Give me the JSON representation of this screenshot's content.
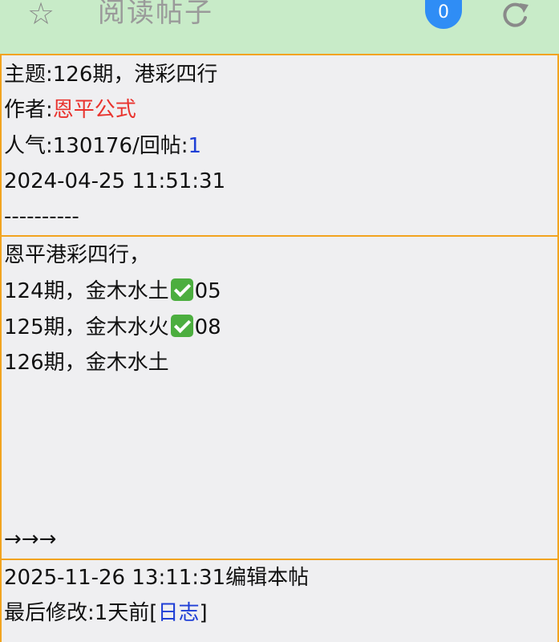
{
  "header": {
    "star_icon": "☆",
    "title": "阅读帖子",
    "badge_count": "0",
    "refresh_icon": "refresh-icon"
  },
  "post_info": {
    "subject_label": "主题:",
    "subject_value": "126期，港彩四行",
    "author_label": "作者:",
    "author_value": "恩平公式",
    "popularity_label": "人气:130176/回帖:",
    "reply_count": "1",
    "timestamp": "2024-04-25 11:51:31",
    "divider": "----------"
  },
  "post_body": {
    "line1": "恩平港彩四行，",
    "line2_prefix": "124期，金木水土",
    "line2_suffix": "05",
    "line3_prefix": "125期，金木水火",
    "line3_suffix": "08",
    "line4": "126期，金木水土",
    "arrows": "→→→"
  },
  "post_meta": {
    "edit_text": "2025-11-26 13:11:31编辑本帖",
    "last_modified_prefix": "最后修改:1天前[",
    "log_link": "日志",
    "last_modified_suffix": "]"
  },
  "colors": {
    "header_bg": "#c8ebc8",
    "border": "#f2a31f",
    "author": "#e9332e",
    "link": "#1f3fd6",
    "badge": "#2f8df5",
    "check": "#4cae3f"
  }
}
